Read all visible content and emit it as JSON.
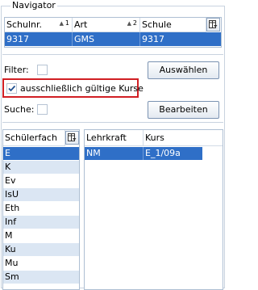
{
  "navigator": {
    "title": "Navigator"
  },
  "top_grid": {
    "columns": [
      {
        "label": "Schulnr.",
        "sort_order": "1"
      },
      {
        "label": "Art",
        "sort_order": "2"
      },
      {
        "label": "Schule",
        "sort_order": ""
      }
    ],
    "selected_row": [
      "9317",
      "GMS",
      "9317"
    ]
  },
  "filter": {
    "label": "Filter:",
    "checked": false,
    "button_label": "Auswählen"
  },
  "valid_courses": {
    "label": "ausschließlich gültige Kurse",
    "checked": true
  },
  "search": {
    "label": "Suche:",
    "checked": false,
    "button_label": "Bearbeiten"
  },
  "subject_grid": {
    "header": "Schülerfach",
    "rows": [
      "E",
      "K",
      "Ev",
      "IsU",
      "Eth",
      "Inf",
      "M",
      "Ku",
      "Mu",
      "Sm"
    ],
    "selected_index": 0
  },
  "course_grid": {
    "columns": [
      "Lehrkraft",
      "Kurs"
    ],
    "rows": [
      [
        "NM",
        "E_1/09a"
      ]
    ]
  },
  "colors": {
    "selection": "#2f6fc7",
    "alt_row": "#dbe6f3",
    "highlight_border": "#d11f24"
  }
}
